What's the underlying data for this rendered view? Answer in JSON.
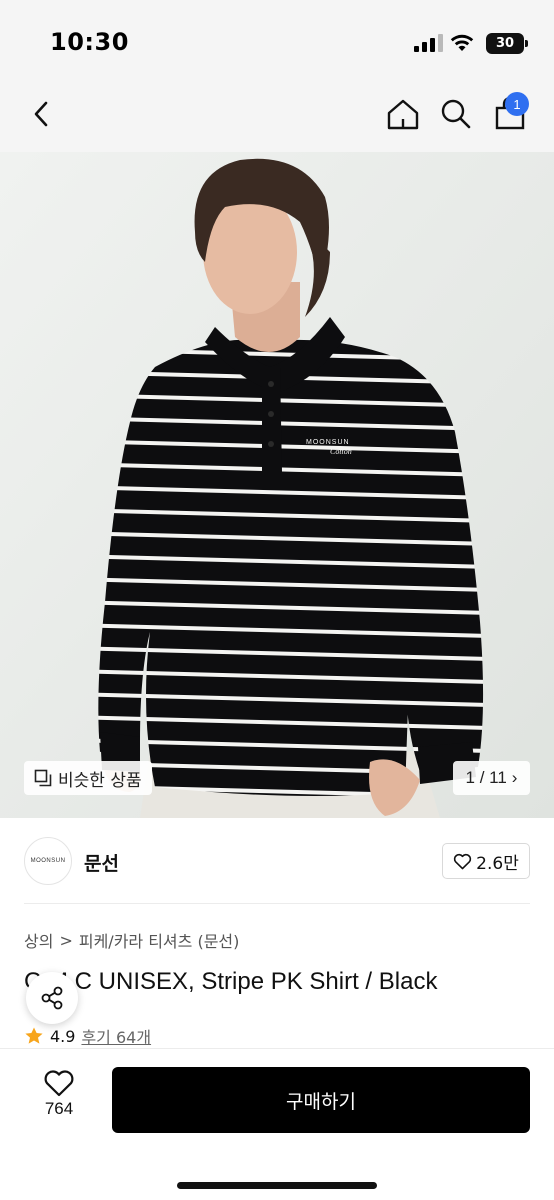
{
  "status": {
    "time": "10:30",
    "battery": "30"
  },
  "nav": {
    "cart_count": "1"
  },
  "hero": {
    "similar_label": "비슷한 상품",
    "pager": "1 / 11",
    "pager_arrow": "›"
  },
  "brand": {
    "logo_text": "MOONSUN",
    "name": "문선",
    "likes": "2.6만"
  },
  "breadcrumb": {
    "category": "상의",
    "separator": ">",
    "subcategory": "피케/카라 티셔츠 (문선)"
  },
  "product": {
    "title": "C.M.C UNISEX, Stripe PK Shirt / Black",
    "rating": "4.9",
    "reviews": "후기 64개"
  },
  "bottom": {
    "wish_count": "764",
    "buy_label": "구매하기"
  },
  "colors": {
    "accent": "#2f6ff0",
    "star": "#f7a51c",
    "primary_button": "#000000"
  },
  "icons": [
    "back-icon",
    "home-icon",
    "search-icon",
    "shopping-bag-icon",
    "similar-icon",
    "heart-icon",
    "share-icon",
    "star-icon"
  ]
}
